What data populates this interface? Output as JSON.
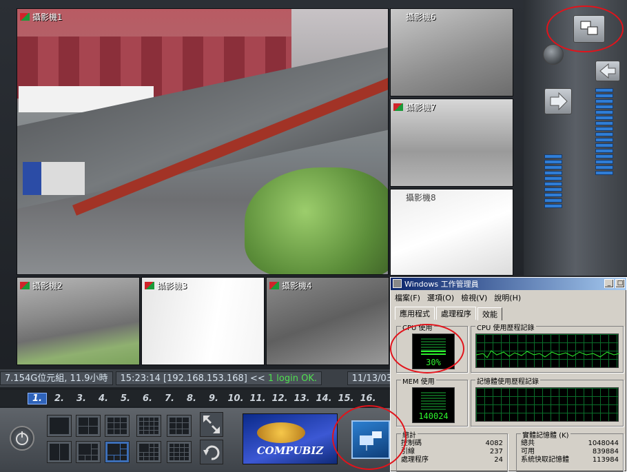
{
  "cameras": [
    {
      "id": "cam1",
      "label": "攝影機1"
    },
    {
      "id": "cam6",
      "label": "攝影機6"
    },
    {
      "id": "cam7",
      "label": "攝影機7"
    },
    {
      "id": "cam8",
      "label": "攝影機8"
    },
    {
      "id": "cam2",
      "label": "攝影機2"
    },
    {
      "id": "cam3",
      "label": "攝影機3"
    },
    {
      "id": "cam4",
      "label": "攝影機4"
    }
  ],
  "status": {
    "storage": "7.154G位元組, 11.9小時",
    "log_prefix": "15:23:14 [192.168.153.168] <<",
    "log_msg": "1 login OK.",
    "date": "11/13/03"
  },
  "pages": [
    "1.",
    "2.",
    "3.",
    "4.",
    "5.",
    "6.",
    "7.",
    "8.",
    "9.",
    "10.",
    "11.",
    "12.",
    "13.",
    "14.",
    "15.",
    "16."
  ],
  "active_page": "1.",
  "brand": {
    "logo_text": "COMPUBIZ"
  },
  "taskmgr": {
    "title": "Windows 工作管理員",
    "minimize": "_",
    "maximize": "□",
    "menu": [
      "檔案(F)",
      "選項(O)",
      "檢視(V)",
      "說明(H)"
    ],
    "tabs": [
      "應用程式",
      "處理程序",
      "效能"
    ],
    "selected_tab": "效能",
    "cpu_usage_title": "CPU 使用",
    "cpu_usage_value": "30%",
    "cpu_usage_fraction": 0.3,
    "cpu_history_title": "CPU 使用歷程記錄",
    "mem_usage_title": "MEM 使用",
    "mem_usage_value": "140024",
    "mem_history_title": "記憶體使用歷程記錄",
    "totals_title": "總計",
    "totals": [
      {
        "label": "控制碼",
        "value": "4082"
      },
      {
        "label": "引線",
        "value": "237"
      },
      {
        "label": "處理程序",
        "value": "24"
      }
    ],
    "physmem_title": "實體記憶體 (K)",
    "physmem": [
      {
        "label": "總共",
        "value": "1048044"
      },
      {
        "label": "可用",
        "value": "839884"
      },
      {
        "label": "系統快取記憶體",
        "value": "113984"
      }
    ]
  },
  "colors": {
    "annotation": "#e2131b",
    "active_page_bg": "#2f63b9",
    "meter_green": "#2df22d"
  }
}
